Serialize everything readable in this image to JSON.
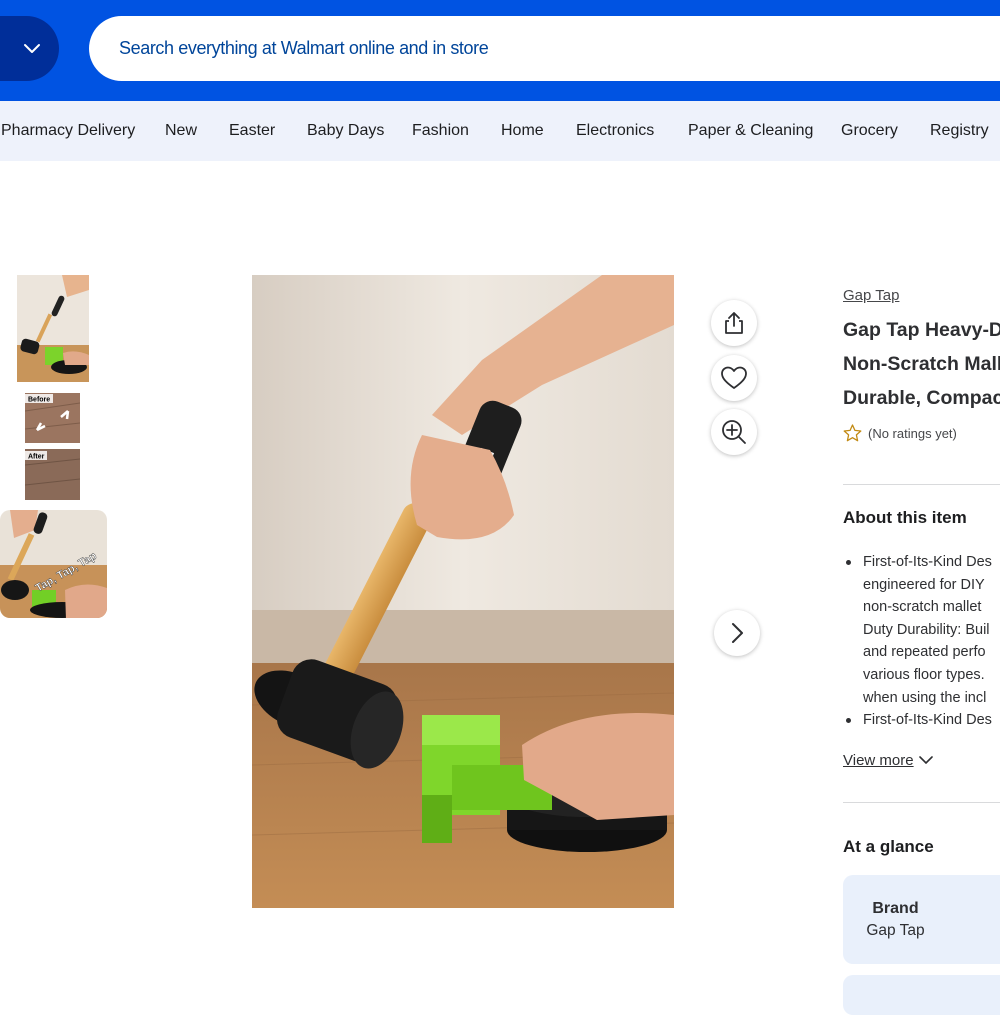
{
  "header": {
    "search_placeholder": "Search everything at Walmart online and in store",
    "brand_color": "#0053e2"
  },
  "nav": {
    "items": [
      "Pharmacy Delivery",
      "New",
      "Easter",
      "Baby Days",
      "Fashion",
      "Home",
      "Electronics",
      "Paper & Cleaning",
      "Grocery",
      "Registry"
    ]
  },
  "gallery": {
    "thumbnails": [
      {
        "icon": "product-photo-hammer"
      },
      {
        "icon": "product-photo-before-after",
        "text_top": "Before",
        "text_bottom": "After"
      },
      {
        "icon": "product-photo-tap-tap-tap",
        "caption": "Tap, Tap, Tap",
        "selected": true
      }
    ],
    "main_image_icon": "product-photo-mallet-on-floor"
  },
  "actions": {
    "share_icon": "share-icon",
    "favorite_icon": "heart-icon",
    "zoom_icon": "zoom-in-icon",
    "next_icon": "chevron-right-icon"
  },
  "product": {
    "brand": "Gap Tap",
    "title_lines": [
      "Gap Tap Heavy-D",
      "Non-Scratch Mall",
      "Durable, Compac"
    ],
    "rating_text": "(No ratings yet)"
  },
  "about": {
    "heading": "About this item",
    "bullets": [
      [
        "First-of-Its-Kind Des",
        "engineered for DIY",
        "non-scratch mallet",
        "Duty Durability: Buil",
        "and repeated perfo",
        "various floor types.",
        "when using the incl"
      ],
      [
        "First-of-Its-Kind Des"
      ]
    ],
    "view_more": "View more"
  },
  "glance": {
    "heading": "At a glance",
    "cards": [
      {
        "key": "Brand",
        "value": "Gap Tap"
      }
    ]
  }
}
